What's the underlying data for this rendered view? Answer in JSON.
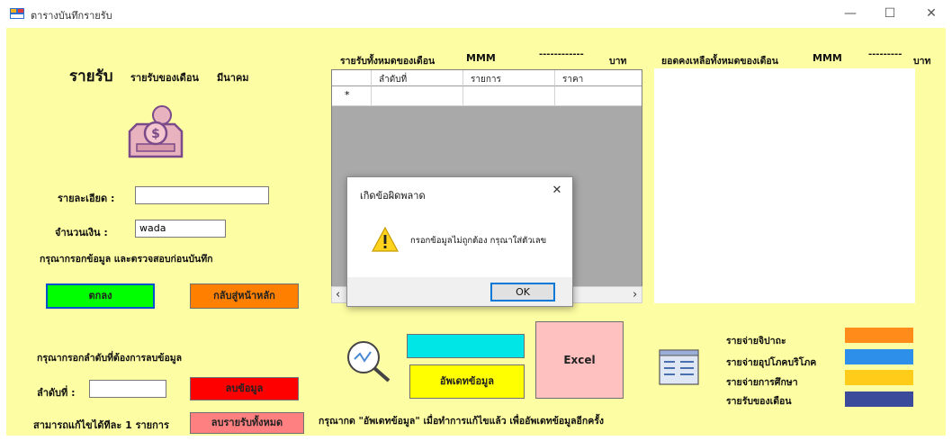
{
  "window": {
    "title": "ตารางบันทึกรายรับ",
    "minimize_glyph": "—",
    "maximize_glyph": "☐",
    "close_glyph": "✕"
  },
  "left": {
    "heading": "รายรับ",
    "month_label": "รายรับของเดือน",
    "month_value": "มีนาคม",
    "detail_label": "รายละเอียด :",
    "detail_value": "",
    "amount_label": "จำนวนเงิน :",
    "amount_value": "wada",
    "hint": "กรุณากรอกข้อมูล และตรวจสอบก่อนบันทึก",
    "ok_button": "ตกลง",
    "home_button": "กลับสู่หน้าหลัก",
    "delete_prompt": "กรุณากรอกลำดับที่ต้องการลบข้อมูล",
    "index_label": "ลำดับที่ :",
    "index_value": "",
    "delete_button": "ลบข้อมูล",
    "edit_note": "สามารถแก้ไขได้ทีละ 1 รายการ",
    "delete_all_button": "ลบรายรับทั้งหมด"
  },
  "grid": {
    "title": "รายรับทั้งหมดของเดือน",
    "month_code": "MMM",
    "total_value": "------------",
    "currency": "บาท",
    "columns": [
      "ลำดับที่",
      "รายการ",
      "ราคา"
    ],
    "new_row_marker": "*",
    "scroll_left": "‹",
    "scroll_right": "›"
  },
  "right": {
    "title": "ยอดคงเหลือทั้งหมดของเดือน",
    "month_code": "MMM",
    "total_value": "---------",
    "currency": "บาท"
  },
  "actions": {
    "update_button": "อัพเดทข้อมูล",
    "excel_button": "Excel",
    "footer_note": "กรุณากด \"อัพเดทข้อมูล\" เมื่อทำการแก้ไขแล้ว เพื่ออัพเดทข้อมูลอีกครั้ง"
  },
  "legend": [
    {
      "label": "รายจ่ายจิปาถะ",
      "color": "#ff8c1a"
    },
    {
      "label": "รายจ่ายอุปโภคบริโภค",
      "color": "#2e8fea"
    },
    {
      "label": "รายจ่ายการศึกษา",
      "color": "#ffcc1a"
    },
    {
      "label": "รายรับของเดือน",
      "color": "#3b4a9a"
    }
  ],
  "dialog": {
    "title": "เกิดข้อผิดพลาด",
    "message": "กรอกข้อมูลไม่ถูกต้อง กรุณาใส่ตัวเลข",
    "ok_button": "OK",
    "close_glyph": "✕",
    "icon": "warning-icon"
  },
  "colors": {
    "background": "#fdfda3",
    "ok_green": "#00ff00",
    "home_orange": "#ff8000",
    "delete_red": "#ff0000",
    "delete_all_pink": "#ff8080",
    "update_yellow": "#ffff00",
    "cyan_button": "#00e5e5",
    "excel_pink": "#ffc0c0"
  }
}
